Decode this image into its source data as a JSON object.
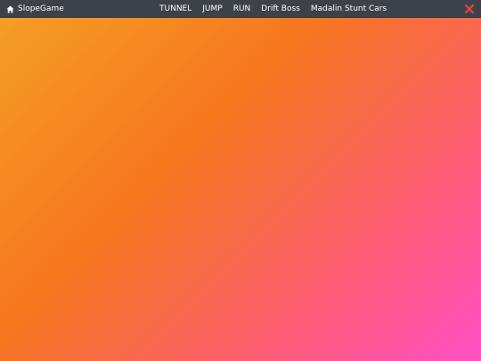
{
  "header": {
    "brand": {
      "label": "SlopeGame",
      "icon": "home-icon"
    },
    "nav": [
      {
        "label": "TUNNEL"
      },
      {
        "label": "JUMP"
      },
      {
        "label": "RUN"
      },
      {
        "label": "Drift Boss"
      },
      {
        "label": "Madalin Stunt Cars"
      }
    ],
    "close": {
      "icon": "close-icon",
      "color": "#e8423f"
    }
  },
  "background": {
    "colors": [
      "#f4a024",
      "#f7761f",
      "#fb5f6a",
      "#ff4fc4"
    ]
  }
}
